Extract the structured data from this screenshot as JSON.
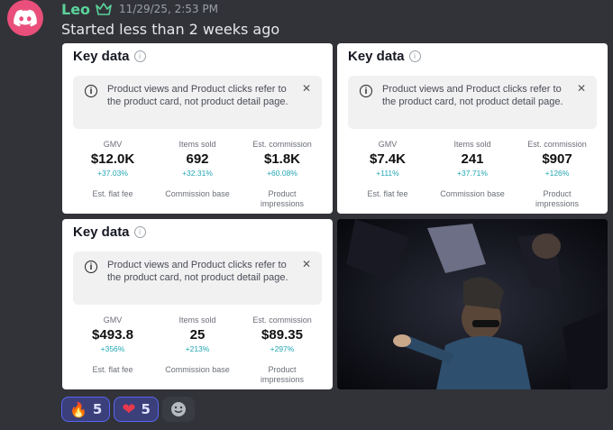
{
  "message": {
    "username": "Leo",
    "timestamp": "11/29/25, 2:53 PM",
    "text": "Started less than 2 weeks ago"
  },
  "colors": {
    "accent": "#5865f2",
    "username": "#5bd29a",
    "change": "#21a6b3",
    "avatar": "#e94f7a"
  },
  "cards": [
    {
      "title": "Key data",
      "notice": "Product views and Product clicks refer to the product card, not product detail page.",
      "metrics": [
        {
          "label": "GMV",
          "value": "$12.0K",
          "change": "+37.03%"
        },
        {
          "label": "Items sold",
          "value": "692",
          "change": "+32.31%"
        },
        {
          "label": "Est. commission",
          "value": "$1.8K",
          "change": "+60.08%"
        }
      ],
      "row2": [
        "Est. flat fee",
        "Commission base",
        "Product impressions"
      ]
    },
    {
      "title": "Key data",
      "notice": "Product views and Product clicks refer to the product card, not product detail page.",
      "metrics": [
        {
          "label": "GMV",
          "value": "$7.4K",
          "change": "+111%"
        },
        {
          "label": "Items sold",
          "value": "241",
          "change": "+37.71%"
        },
        {
          "label": "Est. commission",
          "value": "$907",
          "change": "+126%"
        }
      ],
      "row2": [
        "Est. flat fee",
        "Commission base",
        "Product impressions"
      ]
    },
    {
      "title": "Key data",
      "notice": "Product views and Product clicks refer to the product card, not product detail page.",
      "metrics": [
        {
          "label": "GMV",
          "value": "$493.8",
          "change": "+356%"
        },
        {
          "label": "Items sold",
          "value": "25",
          "change": "+213%"
        },
        {
          "label": "Est. commission",
          "value": "$89.35",
          "change": "+297%"
        }
      ],
      "row2": [
        "Est. flat fee",
        "Commission base",
        "Product impressions"
      ]
    }
  ],
  "reactions": [
    {
      "emoji": "🔥",
      "count": "5",
      "icon": "fire-icon"
    },
    {
      "emoji": "❤",
      "count": "5",
      "icon": "heart-icon"
    }
  ],
  "add_reaction_icon": "smiley-icon"
}
